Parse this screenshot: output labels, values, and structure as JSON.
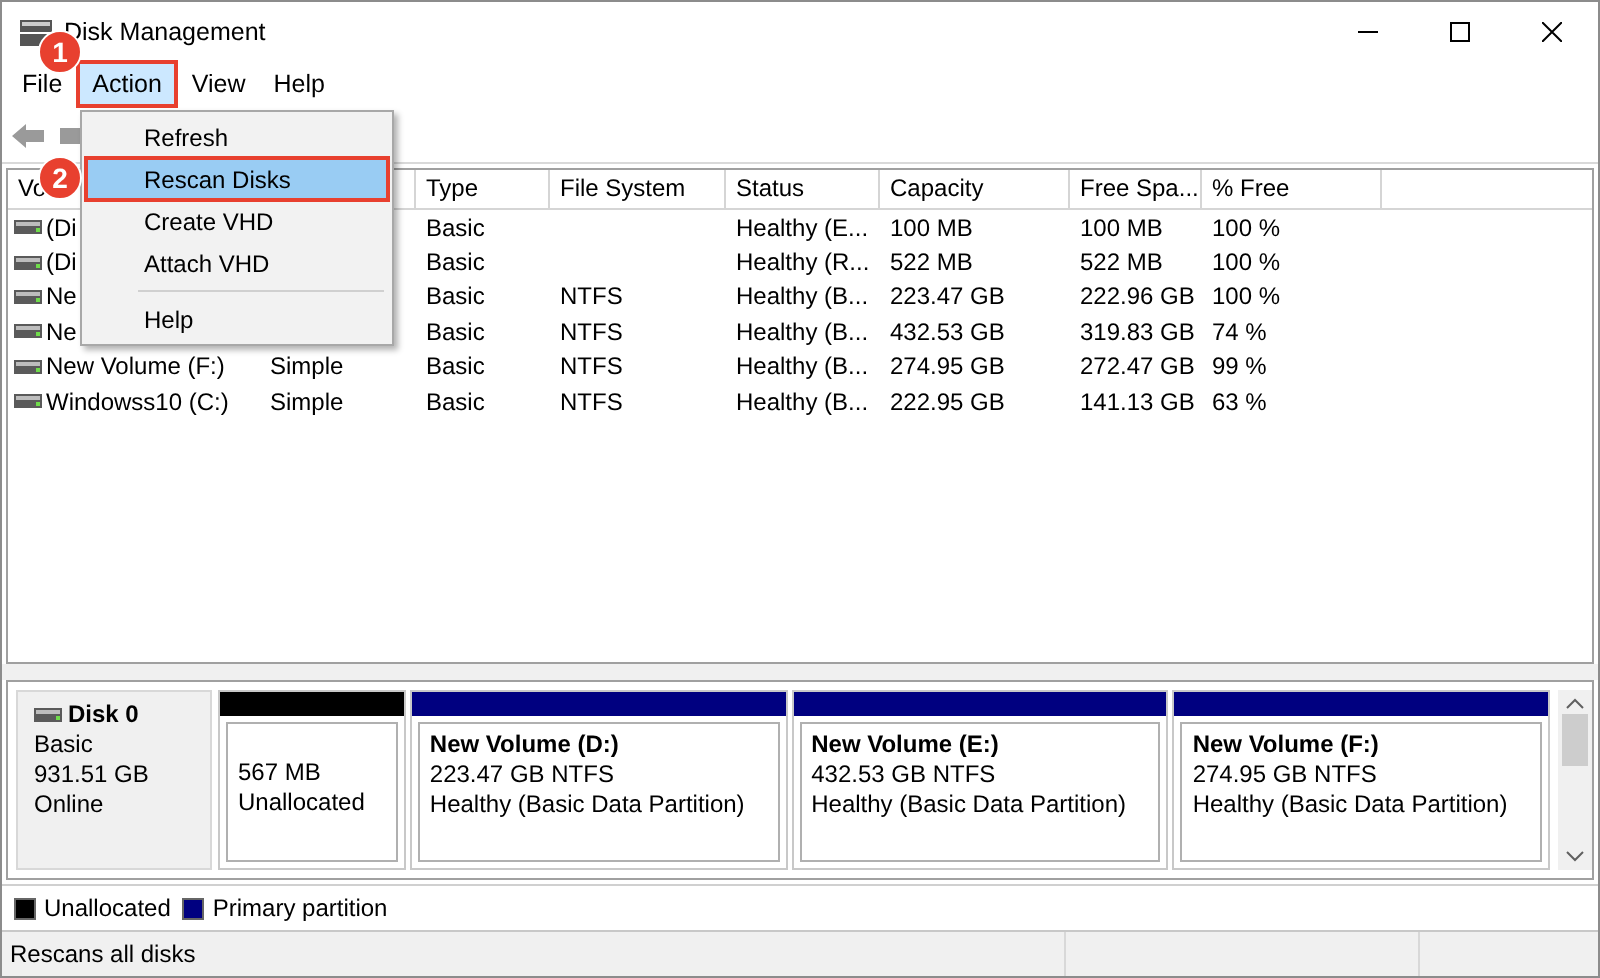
{
  "window": {
    "title": "Disk Management"
  },
  "menu_bar": [
    {
      "label": "File",
      "selected": false
    },
    {
      "label": "Action",
      "selected": true
    },
    {
      "label": "View",
      "selected": false
    },
    {
      "label": "Help",
      "selected": false
    }
  ],
  "action_menu": [
    {
      "kind": "item",
      "label": "Refresh",
      "selected": false
    },
    {
      "kind": "item",
      "label": "Rescan Disks",
      "selected": true
    },
    {
      "kind": "item",
      "label": "Create VHD",
      "selected": false
    },
    {
      "kind": "item",
      "label": "Attach VHD",
      "selected": false
    },
    {
      "kind": "separator"
    },
    {
      "kind": "item",
      "label": "Help",
      "selected": false
    }
  ],
  "annotations": [
    {
      "label": "1"
    },
    {
      "label": "2"
    }
  ],
  "volume_table": {
    "columns": [
      "Vo",
      null,
      "Type",
      "File System",
      "Status",
      "Capacity",
      "Free Spa...",
      "% Free"
    ],
    "rows": [
      [
        "(Di",
        null,
        "Basic",
        null,
        "Healthy (E...",
        "100 MB",
        "100 MB",
        "100 %"
      ],
      [
        "(Di",
        null,
        "Basic",
        null,
        "Healthy (R...",
        "522 MB",
        "522 MB",
        "100 %"
      ],
      [
        "Ne",
        null,
        "Basic",
        "NTFS",
        "Healthy (B...",
        "223.47 GB",
        "222.96 GB",
        "100 %"
      ],
      [
        "Ne",
        null,
        "Basic",
        "NTFS",
        "Healthy (B...",
        "432.53 GB",
        "319.83 GB",
        "74 %"
      ],
      [
        "New Volume (F:)",
        "Simple",
        "Basic",
        "NTFS",
        "Healthy (B...",
        "274.95 GB",
        "272.47 GB",
        "99 %"
      ],
      [
        "Windowss10 (C:)",
        "Simple",
        "Basic",
        "NTFS",
        "Healthy (B...",
        "222.95 GB",
        "141.13 GB",
        "63 %"
      ]
    ]
  },
  "disk": {
    "name": "Disk 0",
    "type": "Basic",
    "size": "931.51 GB",
    "status": "Online",
    "partitions": [
      {
        "kind": "unallocated",
        "color": "#000000",
        "size": "567 MB",
        "label": "Unallocated"
      },
      {
        "kind": "primary",
        "color": "#000080",
        "name": "New Volume  (D:)",
        "size": "223.47 GB NTFS",
        "status": "Healthy (Basic Data Partition)"
      },
      {
        "kind": "primary",
        "color": "#000080",
        "name": "New Volume  (E:)",
        "size": "432.53 GB NTFS",
        "status": "Healthy (Basic Data Partition)"
      },
      {
        "kind": "primary",
        "color": "#000080",
        "name": "New Volume  (F:)",
        "size": "274.95 GB NTFS",
        "status": "Healthy (Basic Data Partition)"
      }
    ]
  },
  "legend": [
    {
      "label": "Unallocated",
      "color": "#000000"
    },
    {
      "label": "Primary partition",
      "color": "#000080"
    }
  ],
  "status_bar": {
    "text": "Rescans all disks"
  }
}
